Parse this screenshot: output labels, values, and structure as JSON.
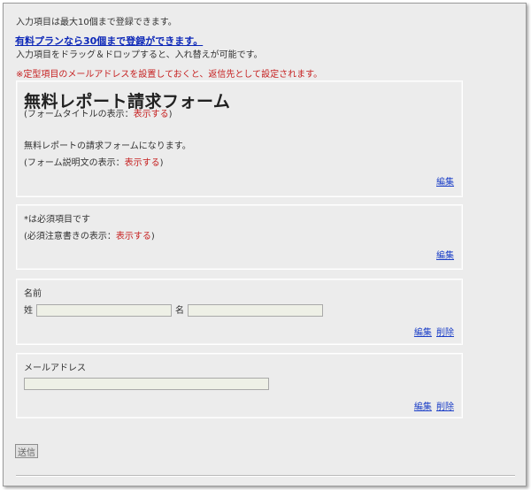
{
  "notice": {
    "max_items": "入力項目は最大10個まで登録できます。",
    "upgrade_link": "有料プランなら30個まで登録ができます。",
    "drag_hint": "入力項目をドラッグ＆ドロップすると、入れ替えが可能です。",
    "email_warning": "※定型項目のメールアドレスを設置しておくと、返信先として設定されます。"
  },
  "title_block": {
    "form_title": "無料レポート請求フォーム",
    "title_display_prefix": "(フォームタイトルの表示：",
    "title_display_value": "表示する",
    "title_display_suffix": ")",
    "description": "無料レポートの請求フォームになります。",
    "desc_display_prefix": "(フォーム説明文の表示：",
    "desc_display_value": "表示する",
    "desc_display_suffix": ")",
    "edit_label": "編集"
  },
  "required_block": {
    "note": "*は必須項目です",
    "display_prefix": "(必須注意書きの表示：",
    "display_value": "表示する",
    "display_suffix": ")",
    "edit_label": "編集"
  },
  "name_field": {
    "label": "名前",
    "last_label": "姓",
    "first_label": "名",
    "last_value": "",
    "first_value": "",
    "edit_label": "編集",
    "delete_label": "削除"
  },
  "email_field": {
    "label": "メールアドレス",
    "value": "",
    "edit_label": "編集",
    "delete_label": "削除"
  },
  "submit": {
    "label": "送信"
  },
  "colors": {
    "accent_link": "#0d28b8",
    "warning": "#c62020",
    "background": "#ececec"
  }
}
